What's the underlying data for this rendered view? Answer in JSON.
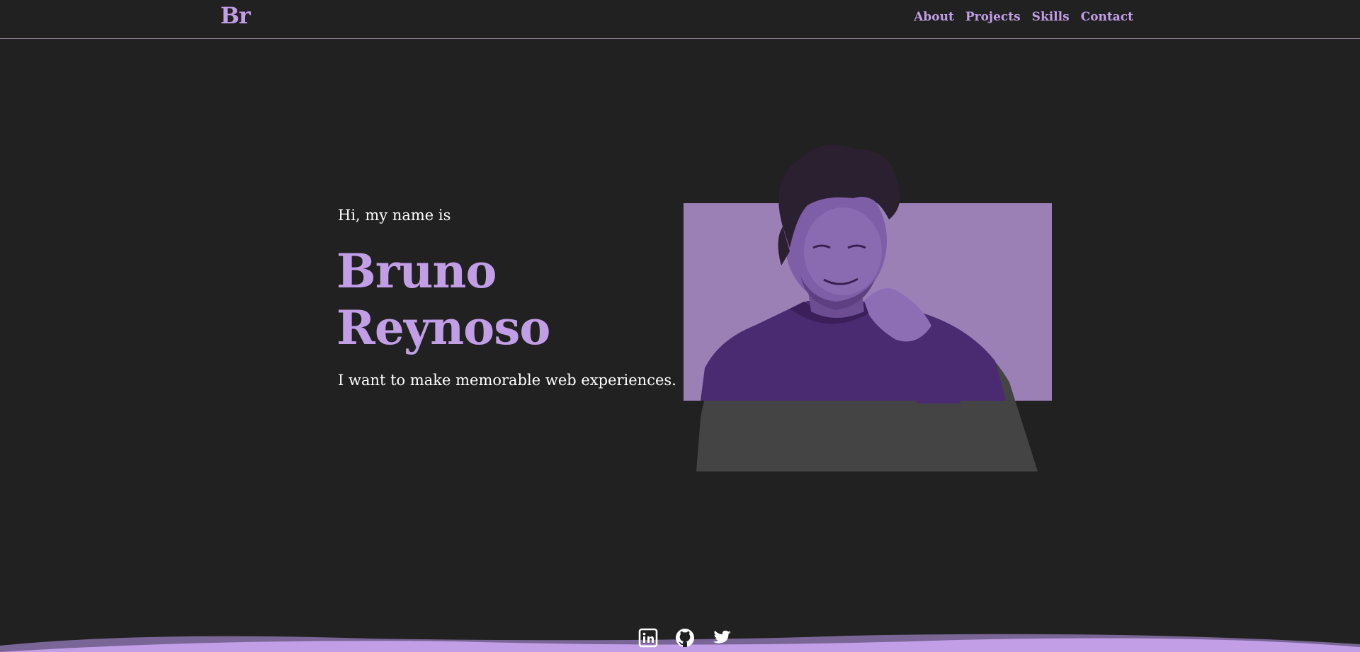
{
  "header": {
    "logo": "Br",
    "nav": [
      {
        "label": "About"
      },
      {
        "label": "Projects"
      },
      {
        "label": "Skills"
      },
      {
        "label": "Contact"
      }
    ]
  },
  "hero": {
    "greeting": "Hi, my name is",
    "first_name": "Bruno",
    "last_name": "Reynoso",
    "tagline": "I want to make memorable web experiences."
  },
  "social": [
    {
      "icon": "linkedin-icon"
    },
    {
      "icon": "github-icon"
    },
    {
      "icon": "twitter-icon"
    }
  ],
  "colors": {
    "background": "#212121",
    "accent": "#c19ee6",
    "photo_box": "#9a80b5",
    "divider": "#8a7f99"
  }
}
